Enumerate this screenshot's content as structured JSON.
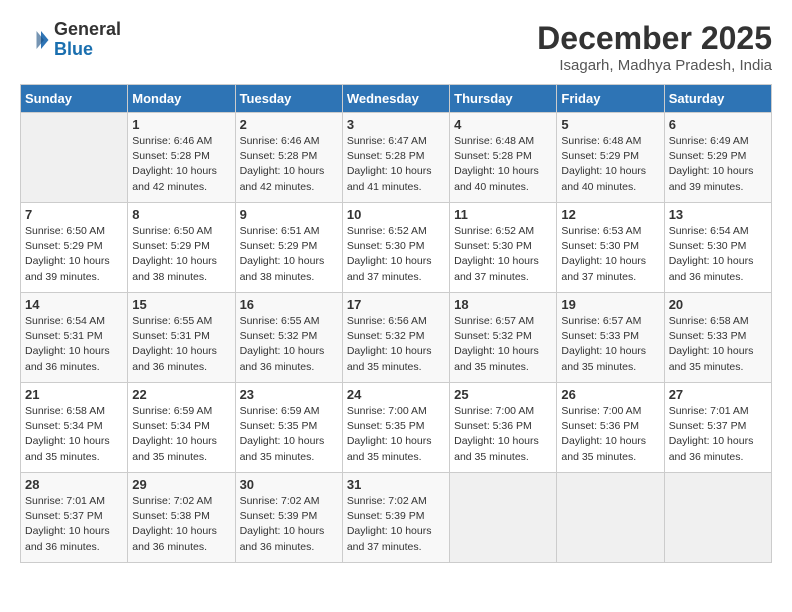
{
  "header": {
    "logo_line1": "General",
    "logo_line2": "Blue",
    "month": "December 2025",
    "location": "Isagarh, Madhya Pradesh, India"
  },
  "weekdays": [
    "Sunday",
    "Monday",
    "Tuesday",
    "Wednesday",
    "Thursday",
    "Friday",
    "Saturday"
  ],
  "weeks": [
    [
      {
        "day": "",
        "info": ""
      },
      {
        "day": "1",
        "info": "Sunrise: 6:46 AM\nSunset: 5:28 PM\nDaylight: 10 hours\nand 42 minutes."
      },
      {
        "day": "2",
        "info": "Sunrise: 6:46 AM\nSunset: 5:28 PM\nDaylight: 10 hours\nand 42 minutes."
      },
      {
        "day": "3",
        "info": "Sunrise: 6:47 AM\nSunset: 5:28 PM\nDaylight: 10 hours\nand 41 minutes."
      },
      {
        "day": "4",
        "info": "Sunrise: 6:48 AM\nSunset: 5:28 PM\nDaylight: 10 hours\nand 40 minutes."
      },
      {
        "day": "5",
        "info": "Sunrise: 6:48 AM\nSunset: 5:29 PM\nDaylight: 10 hours\nand 40 minutes."
      },
      {
        "day": "6",
        "info": "Sunrise: 6:49 AM\nSunset: 5:29 PM\nDaylight: 10 hours\nand 39 minutes."
      }
    ],
    [
      {
        "day": "7",
        "info": "Sunrise: 6:50 AM\nSunset: 5:29 PM\nDaylight: 10 hours\nand 39 minutes."
      },
      {
        "day": "8",
        "info": "Sunrise: 6:50 AM\nSunset: 5:29 PM\nDaylight: 10 hours\nand 38 minutes."
      },
      {
        "day": "9",
        "info": "Sunrise: 6:51 AM\nSunset: 5:29 PM\nDaylight: 10 hours\nand 38 minutes."
      },
      {
        "day": "10",
        "info": "Sunrise: 6:52 AM\nSunset: 5:30 PM\nDaylight: 10 hours\nand 37 minutes."
      },
      {
        "day": "11",
        "info": "Sunrise: 6:52 AM\nSunset: 5:30 PM\nDaylight: 10 hours\nand 37 minutes."
      },
      {
        "day": "12",
        "info": "Sunrise: 6:53 AM\nSunset: 5:30 PM\nDaylight: 10 hours\nand 37 minutes."
      },
      {
        "day": "13",
        "info": "Sunrise: 6:54 AM\nSunset: 5:30 PM\nDaylight: 10 hours\nand 36 minutes."
      }
    ],
    [
      {
        "day": "14",
        "info": "Sunrise: 6:54 AM\nSunset: 5:31 PM\nDaylight: 10 hours\nand 36 minutes."
      },
      {
        "day": "15",
        "info": "Sunrise: 6:55 AM\nSunset: 5:31 PM\nDaylight: 10 hours\nand 36 minutes."
      },
      {
        "day": "16",
        "info": "Sunrise: 6:55 AM\nSunset: 5:32 PM\nDaylight: 10 hours\nand 36 minutes."
      },
      {
        "day": "17",
        "info": "Sunrise: 6:56 AM\nSunset: 5:32 PM\nDaylight: 10 hours\nand 35 minutes."
      },
      {
        "day": "18",
        "info": "Sunrise: 6:57 AM\nSunset: 5:32 PM\nDaylight: 10 hours\nand 35 minutes."
      },
      {
        "day": "19",
        "info": "Sunrise: 6:57 AM\nSunset: 5:33 PM\nDaylight: 10 hours\nand 35 minutes."
      },
      {
        "day": "20",
        "info": "Sunrise: 6:58 AM\nSunset: 5:33 PM\nDaylight: 10 hours\nand 35 minutes."
      }
    ],
    [
      {
        "day": "21",
        "info": "Sunrise: 6:58 AM\nSunset: 5:34 PM\nDaylight: 10 hours\nand 35 minutes."
      },
      {
        "day": "22",
        "info": "Sunrise: 6:59 AM\nSunset: 5:34 PM\nDaylight: 10 hours\nand 35 minutes."
      },
      {
        "day": "23",
        "info": "Sunrise: 6:59 AM\nSunset: 5:35 PM\nDaylight: 10 hours\nand 35 minutes."
      },
      {
        "day": "24",
        "info": "Sunrise: 7:00 AM\nSunset: 5:35 PM\nDaylight: 10 hours\nand 35 minutes."
      },
      {
        "day": "25",
        "info": "Sunrise: 7:00 AM\nSunset: 5:36 PM\nDaylight: 10 hours\nand 35 minutes."
      },
      {
        "day": "26",
        "info": "Sunrise: 7:00 AM\nSunset: 5:36 PM\nDaylight: 10 hours\nand 35 minutes."
      },
      {
        "day": "27",
        "info": "Sunrise: 7:01 AM\nSunset: 5:37 PM\nDaylight: 10 hours\nand 36 minutes."
      }
    ],
    [
      {
        "day": "28",
        "info": "Sunrise: 7:01 AM\nSunset: 5:37 PM\nDaylight: 10 hours\nand 36 minutes."
      },
      {
        "day": "29",
        "info": "Sunrise: 7:02 AM\nSunset: 5:38 PM\nDaylight: 10 hours\nand 36 minutes."
      },
      {
        "day": "30",
        "info": "Sunrise: 7:02 AM\nSunset: 5:39 PM\nDaylight: 10 hours\nand 36 minutes."
      },
      {
        "day": "31",
        "info": "Sunrise: 7:02 AM\nSunset: 5:39 PM\nDaylight: 10 hours\nand 37 minutes."
      },
      {
        "day": "",
        "info": ""
      },
      {
        "day": "",
        "info": ""
      },
      {
        "day": "",
        "info": ""
      }
    ]
  ]
}
